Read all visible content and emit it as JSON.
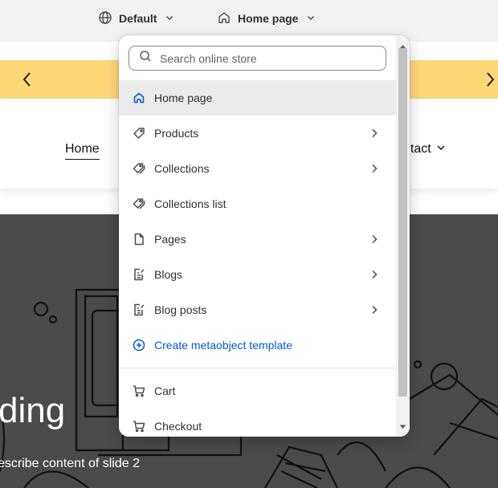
{
  "topbar": {
    "theme_label": "Default",
    "page_label": "Home page"
  },
  "preview": {
    "nav_home": "Home",
    "nav_contact": "ntact",
    "hero_heading": "ding",
    "hero_subtext": "escribe content of slide 2"
  },
  "dropdown": {
    "search_placeholder": "Search online store",
    "items": [
      {
        "label": "Home page",
        "icon": "home-icon",
        "has_submenu": false,
        "selected": true
      },
      {
        "label": "Products",
        "icon": "tag-icon",
        "has_submenu": true
      },
      {
        "label": "Collections",
        "icon": "tags-icon",
        "has_submenu": true
      },
      {
        "label": "Collections list",
        "icon": "tags-icon",
        "has_submenu": false
      },
      {
        "label": "Pages",
        "icon": "page-icon",
        "has_submenu": true
      },
      {
        "label": "Blogs",
        "icon": "blog-icon",
        "has_submenu": true
      },
      {
        "label": "Blog posts",
        "icon": "blog-icon",
        "has_submenu": true
      },
      {
        "label": "Create metaobject template",
        "icon": "plus-circle-icon",
        "has_submenu": false
      }
    ],
    "items_after_divider": [
      {
        "label": "Cart",
        "icon": "cart-icon"
      },
      {
        "label": "Checkout",
        "icon": "cart-icon"
      }
    ]
  },
  "colors": {
    "announcement_bg": "#fed877",
    "selected_item_bg": "#ebebeb",
    "link_blue": "#005bd3",
    "hero_bg": "#4a4a4a"
  }
}
